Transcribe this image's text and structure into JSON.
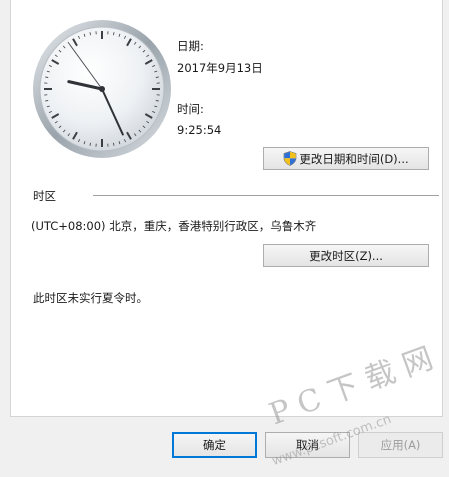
{
  "datetime": {
    "date_label": "日期:",
    "date_value": "2017年9月13日",
    "time_label": "时间:",
    "time_value": "9:25:54",
    "change_datetime_button": "更改日期和时间(D)..."
  },
  "timezone": {
    "section_label": "时区",
    "current_zone": "(UTC+08:00) 北京，重庆，香港特别行政区，乌鲁木齐",
    "change_zone_button": "更改时区(Z)...",
    "dst_note": "此时区未实行夏令时。"
  },
  "footer": {
    "ok_button": "确定",
    "cancel_button": "取消",
    "apply_button": "应用(A)"
  },
  "watermark": {
    "brand": "P C 下 载 网",
    "url": "www.pcsoft.com.cn"
  },
  "clock": {
    "hours": 9,
    "minutes": 25,
    "seconds": 54
  },
  "icons": {
    "uac": "uac-shield-icon",
    "clock": "analog-clock-icon"
  }
}
